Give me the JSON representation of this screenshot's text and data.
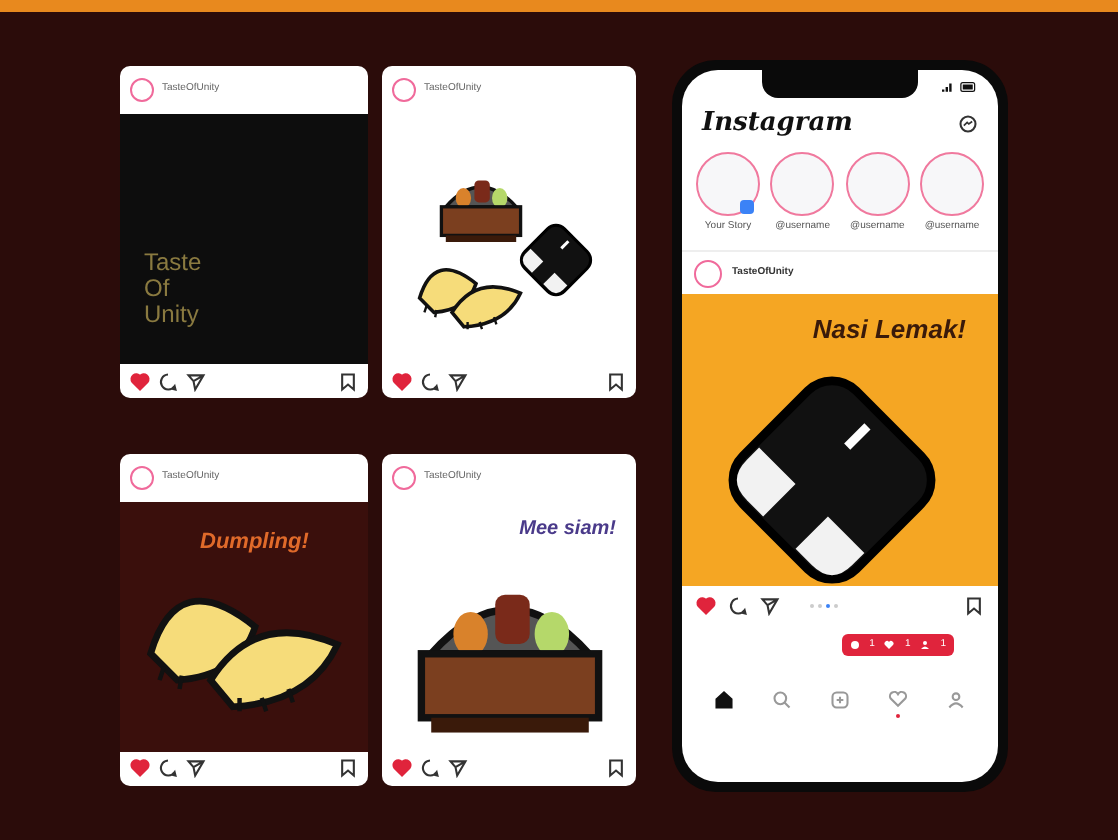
{
  "posts": [
    {
      "username": "TasteOfUnity",
      "kind": "title",
      "color": "#0d0d0d",
      "title_lines": [
        "Taste",
        "Of",
        "Unity"
      ],
      "liked": true
    },
    {
      "username": "TasteOfUnity",
      "kind": "collage",
      "color": "#ffffff",
      "liked": true
    },
    {
      "username": "TasteOfUnity",
      "kind": "dumpling",
      "color": "#3a0f0c",
      "heading": "Dumpling!",
      "liked": true
    },
    {
      "username": "TasteOfUnity",
      "kind": "bento",
      "color": "#ffffff",
      "heading": "Mee siam!",
      "liked": true
    }
  ],
  "phone": {
    "app_title": "Instagram",
    "stories": [
      {
        "label": "Your Story",
        "own": true
      },
      {
        "label": "@username",
        "own": false
      },
      {
        "label": "@username",
        "own": false
      },
      {
        "label": "@username",
        "own": false
      }
    ],
    "post": {
      "username": "TasteOfUnity",
      "kind": "onigiri",
      "color": "#f5a623",
      "heading": "Nasi Lemak!",
      "liked": true,
      "page_dots": [
        {
          "selected": false
        },
        {
          "selected": false
        },
        {
          "selected": true
        },
        {
          "selected": false
        }
      ]
    },
    "notifications": [
      {
        "kind": "comment",
        "count": "1"
      },
      {
        "kind": "like",
        "count": "1"
      },
      {
        "kind": "follow",
        "count": "1"
      }
    ],
    "nav": [
      {
        "kind": "home",
        "selected": true
      },
      {
        "kind": "search",
        "selected": false
      },
      {
        "kind": "add",
        "selected": false
      },
      {
        "kind": "activity",
        "selected": false,
        "has_dot": true
      },
      {
        "kind": "profile",
        "selected": false
      }
    ]
  }
}
